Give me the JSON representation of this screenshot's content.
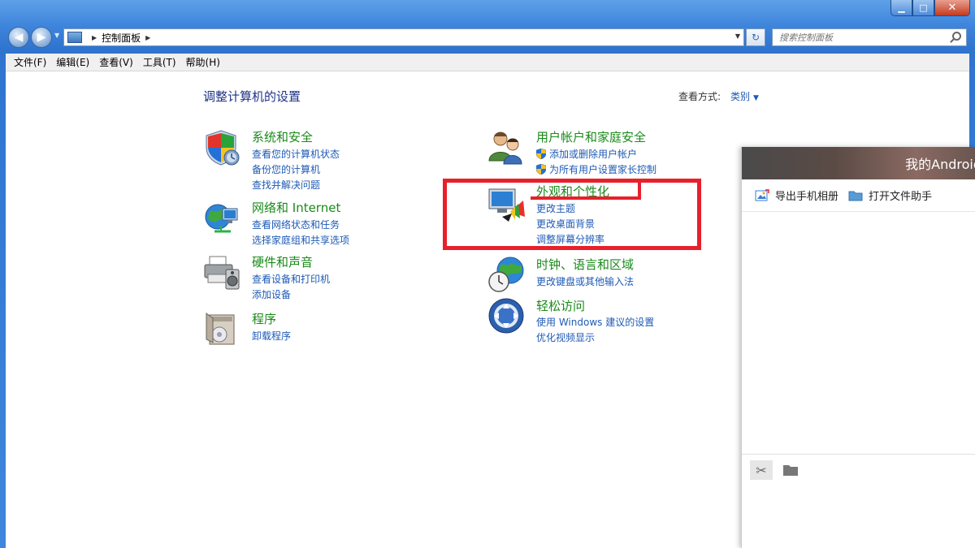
{
  "window": {
    "minimize_label": "▁",
    "maximize_label": "□",
    "close_label": "✕"
  },
  "nav": {
    "back_glyph": "◀",
    "forward_glyph": "▶",
    "address": [
      "控制面板"
    ],
    "search_placeholder": "搜索控制面板"
  },
  "menu": [
    {
      "label": "文件(F)"
    },
    {
      "label": "编辑(E)"
    },
    {
      "label": "查看(V)"
    },
    {
      "label": "工具(T)"
    },
    {
      "label": "帮助(H)"
    }
  ],
  "main": {
    "title": "调整计算机的设置",
    "view_label": "查看方式:",
    "view_value": "类别"
  },
  "categories": {
    "system": {
      "title": "系统和安全",
      "links": [
        "查看您的计算机状态",
        "备份您的计算机",
        "查找并解决问题"
      ]
    },
    "network": {
      "title": "网络和 Internet",
      "links": [
        "查看网络状态和任务",
        "选择家庭组和共享选项"
      ]
    },
    "hardware": {
      "title": "硬件和声音",
      "links": [
        "查看设备和打印机",
        "添加设备"
      ]
    },
    "programs": {
      "title": "程序",
      "links": [
        "卸载程序"
      ]
    },
    "users": {
      "title": "用户帐户和家庭安全",
      "links": [
        "添加或删除用户帐户",
        "为所有用户设置家长控制"
      ]
    },
    "appearance": {
      "title": "外观和个性化",
      "links": [
        "更改主题",
        "更改桌面背景",
        "调整屏幕分辨率"
      ]
    },
    "clock": {
      "title": "时钟、语言和区域",
      "links": [
        "更改键盘或其他输入法"
      ]
    },
    "ease": {
      "title": "轻松访问",
      "links": [
        "使用 Windows 建议的设置",
        "优化视频显示"
      ]
    }
  },
  "panel": {
    "title": "我的Android手机",
    "export_album": "导出手机相册",
    "open_file_helper": "打开文件助手"
  },
  "colors": {
    "highlight": "#e8202c",
    "category_title": "#1a8a1a",
    "link": "#1e5ab5"
  }
}
